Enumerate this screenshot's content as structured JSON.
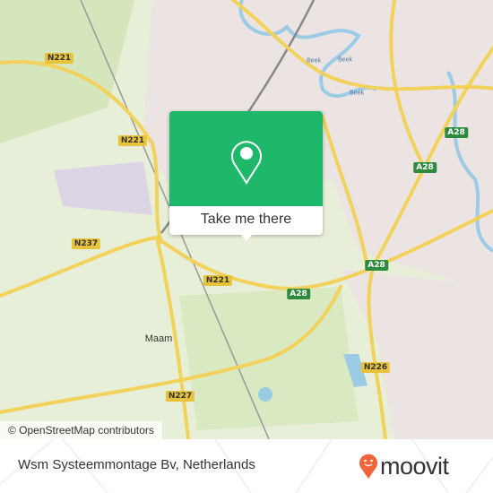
{
  "map": {
    "road_labels": [
      {
        "label": "N221",
        "type": "n"
      },
      {
        "label": "N221",
        "type": "n"
      },
      {
        "label": "N221",
        "type": "n"
      },
      {
        "label": "N237",
        "type": "n"
      },
      {
        "label": "N226",
        "type": "n"
      },
      {
        "label": "N227",
        "type": "n"
      },
      {
        "label": "A28",
        "type": "a"
      },
      {
        "label": "A28",
        "type": "a"
      },
      {
        "label": "A28",
        "type": "a"
      },
      {
        "label": "A28",
        "type": "a"
      }
    ],
    "places": [
      "Maam"
    ],
    "water_labels": [
      "Beek",
      "Beek",
      "Beek"
    ],
    "attribution": "© OpenStreetMap contributors",
    "colors": {
      "land": "#e8efd8",
      "urban": "#ece4e2",
      "road_major": "#f2d25a",
      "water": "#9ccbe6",
      "popup": "#1fb86a"
    }
  },
  "popup": {
    "icon": "location-pin-icon",
    "button_label": "Take me there"
  },
  "footer": {
    "title": "Wsm Systeemmontage Bv, Netherlands",
    "logo_text": "moovit",
    "logo_color": "#f0643c"
  }
}
